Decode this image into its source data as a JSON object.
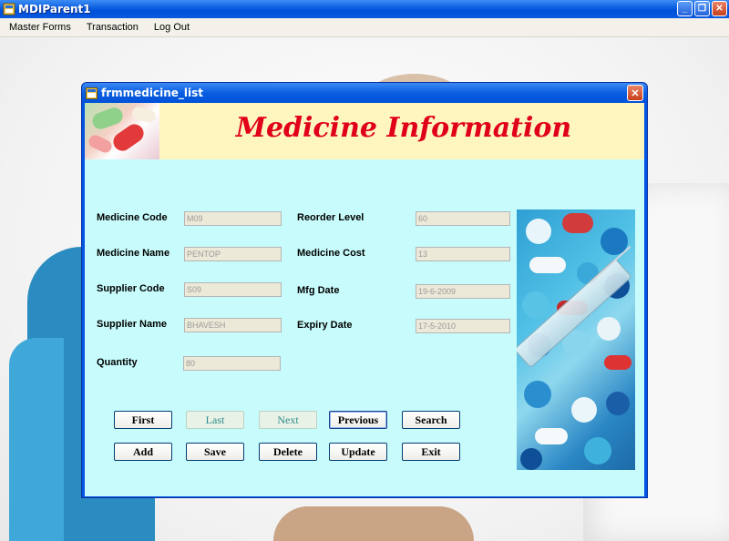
{
  "window": {
    "title": "MDIParent1",
    "controls": {
      "minimize": "_",
      "restore": "❐",
      "close": "✕"
    }
  },
  "menubar": {
    "items": [
      "Master Forms",
      "Transaction",
      "Log Out"
    ]
  },
  "form": {
    "title": "frmmedicine_list",
    "close": "✕",
    "header": "Medicine Information"
  },
  "fields": {
    "medicine_code": {
      "label": "Medicine Code",
      "value": "M09"
    },
    "medicine_name": {
      "label": "Medicine Name",
      "value": "PENTOP"
    },
    "supplier_code": {
      "label": "Supplier Code",
      "value": "S09"
    },
    "supplier_name": {
      "label": "Supplier Name",
      "value": "BHAVESH"
    },
    "quantity": {
      "label": "Quantity",
      "value": "80"
    },
    "reorder_level": {
      "label": "Reorder Level",
      "value": "60"
    },
    "medicine_cost": {
      "label": "Medicine Cost",
      "value": "13"
    },
    "mfg_date": {
      "label": "Mfg Date",
      "value": "19-6-2009"
    },
    "expiry_date": {
      "label": "Expiry Date",
      "value": "17-5-2010"
    }
  },
  "buttons": {
    "first": "First",
    "last": "Last",
    "next": "Next",
    "previous": "Previous",
    "search": "Search",
    "add": "Add",
    "save": "Save",
    "delete": "Delete",
    "update": "Update",
    "exit": "Exit"
  },
  "colors": {
    "title_bar": "#0a5ee0",
    "form_background": "#c8fcfc",
    "header_band": "#fff6bf",
    "header_text": "#e0001a"
  }
}
